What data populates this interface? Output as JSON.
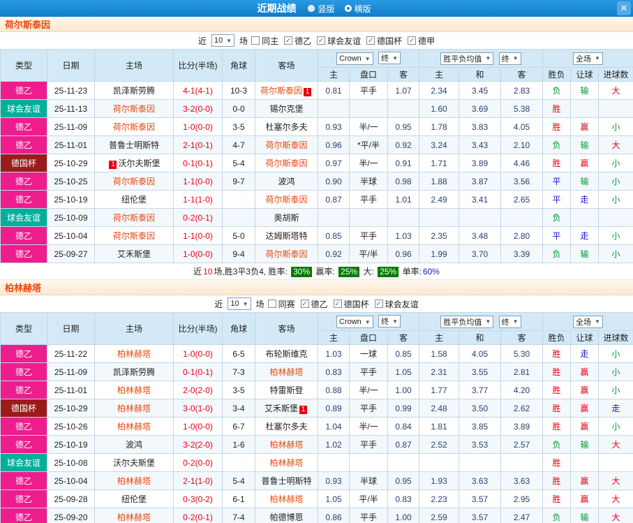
{
  "colors": {
    "red": "#e60012",
    "blue": "#1616d0",
    "green": "#009933",
    "team": "#e8490f",
    "score": "#e60012",
    "type_bg": {
      "德乙": "#ee1d8e",
      "球会友谊": "#00b09b",
      "德国杯": "#9b1b1b"
    },
    "pct_badge_bg": "#007a00"
  },
  "topbar": {
    "title": "近期战绩",
    "radios": [
      {
        "label": "竖版",
        "selected": false
      },
      {
        "label": "横版",
        "selected": true
      }
    ],
    "close": "✕"
  },
  "header_cols": {
    "type": "类型",
    "date": "日期",
    "home": "主场",
    "score": "比分(半场)",
    "corner": "角球",
    "away": "客场",
    "crow": "Crown",
    "end1": "终",
    "avg": "胜平负均值",
    "end2": "终",
    "full": "全场",
    "sub": [
      "主",
      "盘口",
      "客",
      "主",
      "和",
      "客",
      "胜负",
      "让球",
      "进球数"
    ]
  },
  "sections": [
    {
      "team": "荷尔斯泰因",
      "filter": {
        "near": "近",
        "count": "10",
        "games": "场",
        "checkboxes": [
          {
            "label": "同主",
            "checked": false
          },
          {
            "label": "德乙",
            "checked": true
          },
          {
            "label": "球会友谊",
            "checked": true
          },
          {
            "label": "德国杯",
            "checked": true
          },
          {
            "label": "德甲",
            "checked": true
          }
        ]
      },
      "rows": [
        {
          "type": "德乙",
          "date": "25-11-23",
          "home": {
            "name": "凯泽斯劳腾"
          },
          "score": "4-1(4-1)",
          "corner": "10-3",
          "away": {
            "name": "荷尔斯泰因",
            "hl": true,
            "badge": "1",
            "badge_pos": "after"
          },
          "odds": [
            "0.81",
            "平手",
            "1.07",
            "2.34",
            "3.45",
            "2.83"
          ],
          "results": [
            {
              "t": "负",
              "c": "green"
            },
            {
              "t": "输",
              "c": "green"
            },
            {
              "t": "大",
              "c": "red"
            }
          ]
        },
        {
          "type": "球会友谊",
          "date": "25-11-13",
          "home": {
            "name": "荷尔斯泰因",
            "hl": true
          },
          "score": "3-2(0-0)",
          "corner": "0-0",
          "away": {
            "name": "锡尔克堡"
          },
          "odds": [
            "",
            "",
            "",
            "1.60",
            "3.69",
            "5.38"
          ],
          "results": [
            {
              "t": "胜",
              "c": "red"
            },
            {
              "t": ""
            },
            {
              "t": ""
            }
          ]
        },
        {
          "type": "德乙",
          "date": "25-11-09",
          "home": {
            "name": "荷尔斯泰因",
            "hl": true
          },
          "score": "1-0(0-0)",
          "corner": "3-5",
          "away": {
            "name": "杜塞尔多夫"
          },
          "odds": [
            "0.93",
            "半/一",
            "0.95",
            "1.78",
            "3.83",
            "4.05"
          ],
          "results": [
            {
              "t": "胜",
              "c": "red"
            },
            {
              "t": "赢",
              "c": "red"
            },
            {
              "t": "小",
              "c": "green"
            }
          ]
        },
        {
          "type": "德乙",
          "date": "25-11-01",
          "home": {
            "name": "普鲁士明斯特"
          },
          "score": "2-1(0-1)",
          "corner": "4-7",
          "away": {
            "name": "荷尔斯泰因",
            "hl": true
          },
          "odds": [
            "0.96",
            "*平/半",
            "0.92",
            "3.24",
            "3.43",
            "2.10"
          ],
          "results": [
            {
              "t": "负",
              "c": "green"
            },
            {
              "t": "输",
              "c": "green"
            },
            {
              "t": "大",
              "c": "red"
            }
          ]
        },
        {
          "type": "德国杯",
          "date": "25-10-29",
          "home": {
            "name": "沃尔夫斯堡",
            "badge": "1",
            "badge_pos": "before"
          },
          "score": "0-1(0-1)",
          "corner": "5-4",
          "away": {
            "name": "荷尔斯泰因",
            "hl": true
          },
          "odds": [
            "0.97",
            "半/一",
            "0.91",
            "1.71",
            "3.89",
            "4.46"
          ],
          "results": [
            {
              "t": "胜",
              "c": "red"
            },
            {
              "t": "赢",
              "c": "red"
            },
            {
              "t": "小",
              "c": "green"
            }
          ]
        },
        {
          "type": "德乙",
          "date": "25-10-25",
          "home": {
            "name": "荷尔斯泰因",
            "hl": true
          },
          "score": "1-1(0-0)",
          "corner": "9-7",
          "away": {
            "name": "波鸿"
          },
          "odds": [
            "0.90",
            "半球",
            "0.98",
            "1.88",
            "3.87",
            "3.56"
          ],
          "results": [
            {
              "t": "平",
              "c": "blue"
            },
            {
              "t": "输",
              "c": "green"
            },
            {
              "t": "小",
              "c": "green"
            }
          ]
        },
        {
          "type": "德乙",
          "date": "25-10-19",
          "home": {
            "name": "纽伦堡"
          },
          "score": "1-1(1-0)",
          "corner": "",
          "away": {
            "name": "荷尔斯泰因",
            "hl": true
          },
          "odds": [
            "0.87",
            "平手",
            "1.01",
            "2.49",
            "3.41",
            "2.65"
          ],
          "results": [
            {
              "t": "平",
              "c": "blue"
            },
            {
              "t": "走",
              "c": "blue"
            },
            {
              "t": "小",
              "c": "green"
            }
          ]
        },
        {
          "type": "球会友谊",
          "date": "25-10-09",
          "home": {
            "name": "荷尔斯泰因",
            "hl": true
          },
          "score": "0-2(0-1)",
          "corner": "",
          "away": {
            "name": "奥胡斯"
          },
          "odds": [
            "",
            "",
            "",
            "",
            "",
            ""
          ],
          "results": [
            {
              "t": "负",
              "c": "green"
            },
            {
              "t": ""
            },
            {
              "t": ""
            }
          ]
        },
        {
          "type": "德乙",
          "date": "25-10-04",
          "home": {
            "name": "荷尔斯泰因",
            "hl": true
          },
          "score": "1-1(0-0)",
          "corner": "5-0",
          "away": {
            "name": "达姆斯塔特"
          },
          "odds": [
            "0.85",
            "平手",
            "1.03",
            "2.35",
            "3.48",
            "2.80"
          ],
          "results": [
            {
              "t": "平",
              "c": "blue"
            },
            {
              "t": "走",
              "c": "blue"
            },
            {
              "t": "小",
              "c": "green"
            }
          ]
        },
        {
          "type": "德乙",
          "date": "25-09-27",
          "home": {
            "name": "艾禾斯堡"
          },
          "score": "1-0(0-0)",
          "corner": "9-4",
          "away": {
            "name": "荷尔斯泰因",
            "hl": true
          },
          "odds": [
            "0.92",
            "平/半",
            "0.96",
            "1.99",
            "3.70",
            "3.39"
          ],
          "results": [
            {
              "t": "负",
              "c": "green"
            },
            {
              "t": "输",
              "c": "green"
            },
            {
              "t": "小",
              "c": "green"
            }
          ]
        }
      ],
      "summary": [
        {
          "text": "近",
          "style": "plain"
        },
        {
          "text": "10",
          "style": "red"
        },
        {
          "text": "场,胜3平3负4, 胜率: ",
          "style": "plain"
        },
        {
          "text": "30%",
          "style": "badge"
        },
        {
          "text": " 赢率: ",
          "style": "plain"
        },
        {
          "text": "25%",
          "style": "badge"
        },
        {
          "text": " 大: ",
          "style": "plain"
        },
        {
          "text": "25%",
          "style": "badge"
        },
        {
          "text": " 单率:",
          "style": "plain"
        },
        {
          "text": "60%",
          "style": "blue"
        }
      ]
    },
    {
      "team": "柏林赫塔",
      "filter": {
        "near": "近",
        "count": "10",
        "games": "场",
        "checkboxes": [
          {
            "label": "同赛",
            "checked": false
          },
          {
            "label": "德乙",
            "checked": true
          },
          {
            "label": "德国杯",
            "checked": true
          },
          {
            "label": "球会友谊",
            "checked": true
          }
        ]
      },
      "rows": [
        {
          "type": "德乙",
          "date": "25-11-22",
          "home": {
            "name": "柏林赫塔",
            "hl": true
          },
          "score": "1-0(0-0)",
          "corner": "6-5",
          "away": {
            "name": "布轮斯维克"
          },
          "odds": [
            "1.03",
            "一球",
            "0.85",
            "1.58",
            "4.05",
            "5.30"
          ],
          "results": [
            {
              "t": "胜",
              "c": "red"
            },
            {
              "t": "走",
              "c": "blue"
            },
            {
              "t": "小",
              "c": "green"
            }
          ]
        },
        {
          "type": "德乙",
          "date": "25-11-09",
          "home": {
            "name": "凯泽斯劳腾"
          },
          "score": "0-1(0-1)",
          "corner": "7-3",
          "away": {
            "name": "柏林赫塔",
            "hl": true
          },
          "odds": [
            "0.83",
            "平手",
            "1.05",
            "2.31",
            "3.55",
            "2.81"
          ],
          "results": [
            {
              "t": "胜",
              "c": "red"
            },
            {
              "t": "赢",
              "c": "red"
            },
            {
              "t": "小",
              "c": "green"
            }
          ]
        },
        {
          "type": "德乙",
          "date": "25-11-01",
          "home": {
            "name": "柏林赫塔",
            "hl": true
          },
          "score": "2-0(2-0)",
          "corner": "3-5",
          "away": {
            "name": "特雷斯登"
          },
          "odds": [
            "0.88",
            "半/一",
            "1.00",
            "1.77",
            "3.77",
            "4.20"
          ],
          "results": [
            {
              "t": "胜",
              "c": "red"
            },
            {
              "t": "赢",
              "c": "red"
            },
            {
              "t": "小",
              "c": "green"
            }
          ]
        },
        {
          "type": "德国杯",
          "date": "25-10-29",
          "home": {
            "name": "柏林赫塔",
            "hl": true
          },
          "score": "3-0(1-0)",
          "corner": "3-4",
          "away": {
            "name": "艾禾斯堡",
            "badge": "1",
            "badge_pos": "after"
          },
          "odds": [
            "0.89",
            "平手",
            "0.99",
            "2.48",
            "3.50",
            "2.62"
          ],
          "results": [
            {
              "t": "胜",
              "c": "red"
            },
            {
              "t": "赢",
              "c": "red"
            },
            {
              "t": "走",
              "c": "blue"
            }
          ]
        },
        {
          "type": "德乙",
          "date": "25-10-26",
          "home": {
            "name": "柏林赫塔",
            "hl": true
          },
          "score": "1-0(0-0)",
          "corner": "6-7",
          "away": {
            "name": "杜塞尔多夫"
          },
          "odds": [
            "1.04",
            "半/一",
            "0.84",
            "1.81",
            "3.85",
            "3.89"
          ],
          "results": [
            {
              "t": "胜",
              "c": "red"
            },
            {
              "t": "赢",
              "c": "red"
            },
            {
              "t": "小",
              "c": "green"
            }
          ]
        },
        {
          "type": "德乙",
          "date": "25-10-19",
          "home": {
            "name": "波鸿"
          },
          "score": "3-2(2-0)",
          "corner": "1-6",
          "away": {
            "name": "柏林赫塔",
            "hl": true
          },
          "odds": [
            "1.02",
            "平手",
            "0.87",
            "2.52",
            "3.53",
            "2.57"
          ],
          "results": [
            {
              "t": "负",
              "c": "green"
            },
            {
              "t": "输",
              "c": "green"
            },
            {
              "t": "大",
              "c": "red"
            }
          ]
        },
        {
          "type": "球会友谊",
          "date": "25-10-08",
          "home": {
            "name": "沃尔夫斯堡"
          },
          "score": "0-2(0-0)",
          "corner": "",
          "away": {
            "name": "柏林赫塔",
            "hl": true
          },
          "odds": [
            "",
            "",
            "",
            "",
            "",
            ""
          ],
          "results": [
            {
              "t": "胜",
              "c": "red"
            },
            {
              "t": ""
            },
            {
              "t": ""
            }
          ]
        },
        {
          "type": "德乙",
          "date": "25-10-04",
          "home": {
            "name": "柏林赫塔",
            "hl": true
          },
          "score": "2-1(1-0)",
          "corner": "5-4",
          "away": {
            "name": "普鲁士明斯特"
          },
          "odds": [
            "0.93",
            "半球",
            "0.95",
            "1.93",
            "3.63",
            "3.63"
          ],
          "results": [
            {
              "t": "胜",
              "c": "red"
            },
            {
              "t": "赢",
              "c": "red"
            },
            {
              "t": "大",
              "c": "red"
            }
          ]
        },
        {
          "type": "德乙",
          "date": "25-09-28",
          "home": {
            "name": "纽伦堡"
          },
          "score": "0-3(0-2)",
          "corner": "6-1",
          "away": {
            "name": "柏林赫塔",
            "hl": true
          },
          "odds": [
            "1.05",
            "平/半",
            "0.83",
            "2.23",
            "3.57",
            "2.95"
          ],
          "results": [
            {
              "t": "胜",
              "c": "red"
            },
            {
              "t": "赢",
              "c": "red"
            },
            {
              "t": "大",
              "c": "red"
            }
          ]
        },
        {
          "type": "德乙",
          "date": "25-09-20",
          "home": {
            "name": "柏林赫塔",
            "hl": true
          },
          "score": "0-2(0-1)",
          "corner": "7-4",
          "away": {
            "name": "帕德博恩"
          },
          "odds": [
            "0.86",
            "平手",
            "1.00",
            "2.59",
            "3.57",
            "2.47"
          ],
          "results": [
            {
              "t": "负",
              "c": "green"
            },
            {
              "t": "输",
              "c": "green"
            },
            {
              "t": "大",
              "c": "red"
            }
          ]
        }
      ],
      "summary": null
    }
  ]
}
